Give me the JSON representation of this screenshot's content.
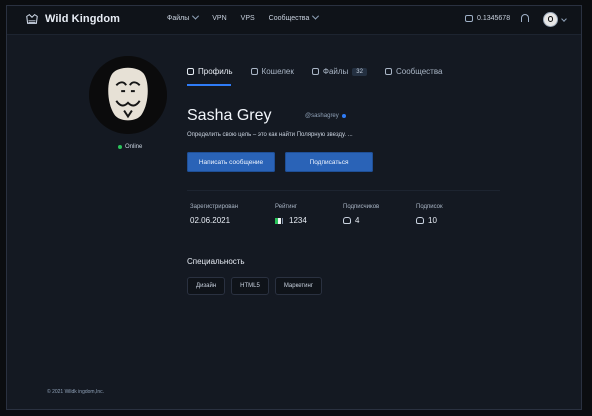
{
  "brand": {
    "name": "Wild Kingdom"
  },
  "nav": {
    "items": [
      {
        "label": "Файлы",
        "has_dropdown": true
      },
      {
        "label": "VPN",
        "has_dropdown": false
      },
      {
        "label": "VPS",
        "has_dropdown": false
      },
      {
        "label": "Сообщества",
        "has_dropdown": true
      }
    ]
  },
  "topbar": {
    "wallet_balance": "0.1345678",
    "icons": {
      "wallet": "wallet-icon",
      "bell": "bell-icon",
      "user_avatar": "user-avatar",
      "dropdown": "chevron-down-icon"
    }
  },
  "profile": {
    "name": "Sasha Grey",
    "handle": "@sashagrey",
    "status": "Online",
    "bio": "Определить свою цель – это как найти Полярную звезду. ...",
    "buttons": {
      "message": "Написать сообщение",
      "subscribe": "Подписаться"
    }
  },
  "tabs": [
    {
      "label": "Профиль",
      "active": true
    },
    {
      "label": "Кошелек",
      "active": false
    },
    {
      "label": "Файлы",
      "badge": "32",
      "active": false
    },
    {
      "label": "Сообщества",
      "active": false
    }
  ],
  "stats": {
    "registered": {
      "label": "Зарегистрирован",
      "value": "02.06.2021"
    },
    "rating": {
      "label": "Рейтинг",
      "value": "1234"
    },
    "subscribers": {
      "label": "Подписчиков",
      "value": "4"
    },
    "subscriptions": {
      "label": "Подписок",
      "value": "10"
    }
  },
  "specialties": {
    "title": "Специальность",
    "items": [
      "Дизайн",
      "HTML5",
      "Маркетинг"
    ]
  },
  "footer": {
    "text": "© 2021 Wildk ingdom,Inc."
  },
  "colors": {
    "accent": "#2f7cf7",
    "button": "#2a63b7",
    "online": "#2ac35a",
    "background": "#141922"
  }
}
